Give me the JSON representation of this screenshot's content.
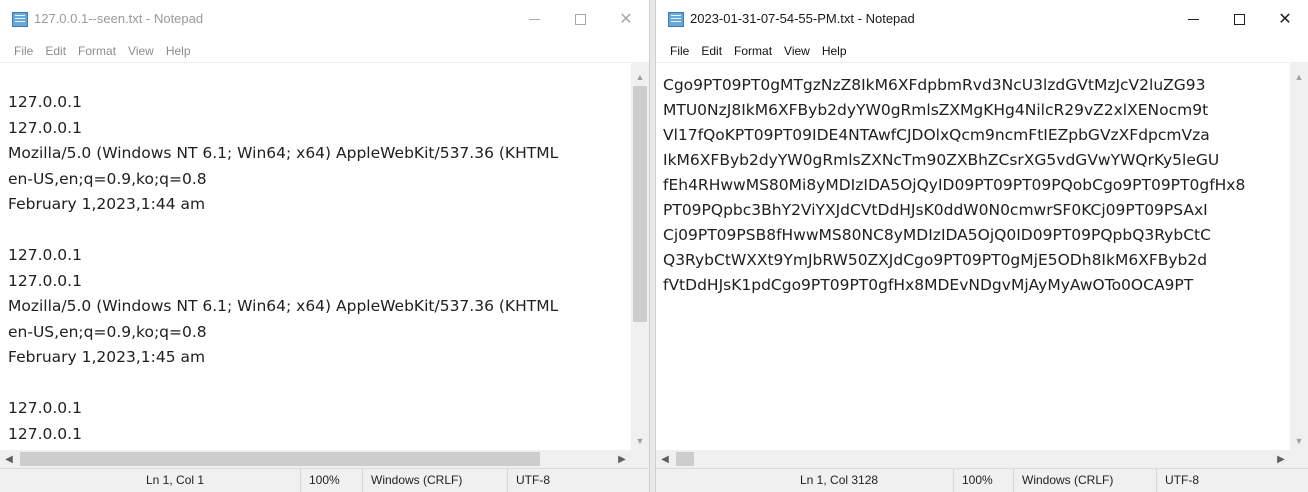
{
  "left_window": {
    "title": "127.0.0.1--seen.txt - Notepad",
    "menu": [
      "File",
      "Edit",
      "Format",
      "View",
      "Help"
    ],
    "lines": [
      "127.0.0.1",
      "127.0.0.1",
      "Mozilla/5.0 (Windows NT 6.1; Win64; x64) AppleWebKit/537.36 (KHTML",
      "en-US,en;q=0.9,ko;q=0.8",
      "February 1,2023,1:44 am",
      "",
      "127.0.0.1",
      "127.0.0.1",
      "Mozilla/5.0 (Windows NT 6.1; Win64; x64) AppleWebKit/537.36 (KHTML",
      "en-US,en;q=0.9,ko;q=0.8",
      "February 1,2023,1:45 am",
      "",
      "127.0.0.1",
      "127.0.0.1"
    ],
    "status": {
      "position": "Ln 1, Col 1",
      "zoom": "100%",
      "line_ending": "Windows (CRLF)",
      "encoding": "UTF-8"
    }
  },
  "right_window": {
    "title": "2023-01-31-07-54-55-PM.txt - Notepad",
    "menu": [
      "File",
      "Edit",
      "Format",
      "View",
      "Help"
    ],
    "lines": [
      "Cgo9PT09PT0gMTgzNzZ8IkM6XFdpbmRvd3NcU3lzdGVtMzJcV2luZG93",
      "MTU0NzJ8IkM6XFByb2dyYW0gRmlsZXMgKHg4NilcR29vZ2xlXENocm9t",
      "Vl17fQoKPT09PT09IDE4NTAwfCJDOlxQcm9ncmFtIEZpbGVzXFdpcmVza",
      "IkM6XFByb2dyYW0gRmlsZXNcTm90ZXBhZCsrXG5vdGVwYWQrKy5leGU",
      "fEh4RHwwMS80Mi8yMDIzIDA5OjQyID09PT09PT09PQobCgo9PT09PT0gfHx8",
      "PT09PQpbc3BhY2ViYXJdCVtDdHJsK0ddW0N0cmwrSF0KCj09PT09PSAxI",
      "Cj09PT09PSB8fHwwMS80NC8yMDIzIDA5OjQ0ID09PT09PQpbQ3RybCtC",
      "Q3RybCtWXXt9YmJbRW50ZXJdCgo9PT09PT0gMjE5ODh8IkM6XFByb2d",
      "fVtDdHJsK1pdCgo9PT09PT0gfHx8MDEvNDgvMjAyMyAwOTo0OCA9PT"
    ],
    "status": {
      "position": "Ln 1, Col 3128",
      "zoom": "100%",
      "line_ending": "Windows (CRLF)",
      "encoding": "UTF-8"
    }
  },
  "icons": {
    "app": "notepad-icon",
    "minimize": "minimize-icon",
    "maximize": "maximize-icon",
    "close": "close-icon",
    "scroll_up": "chevron-up-icon",
    "scroll_down": "chevron-down-icon",
    "scroll_left": "chevron-left-icon",
    "scroll_right": "chevron-right-icon"
  },
  "colors": {
    "window_bg": "#ffffff",
    "chrome_bg": "#f0f0f0",
    "inactive_text": "#9a9a9a",
    "scroll_thumb": "#cdcdcd"
  }
}
